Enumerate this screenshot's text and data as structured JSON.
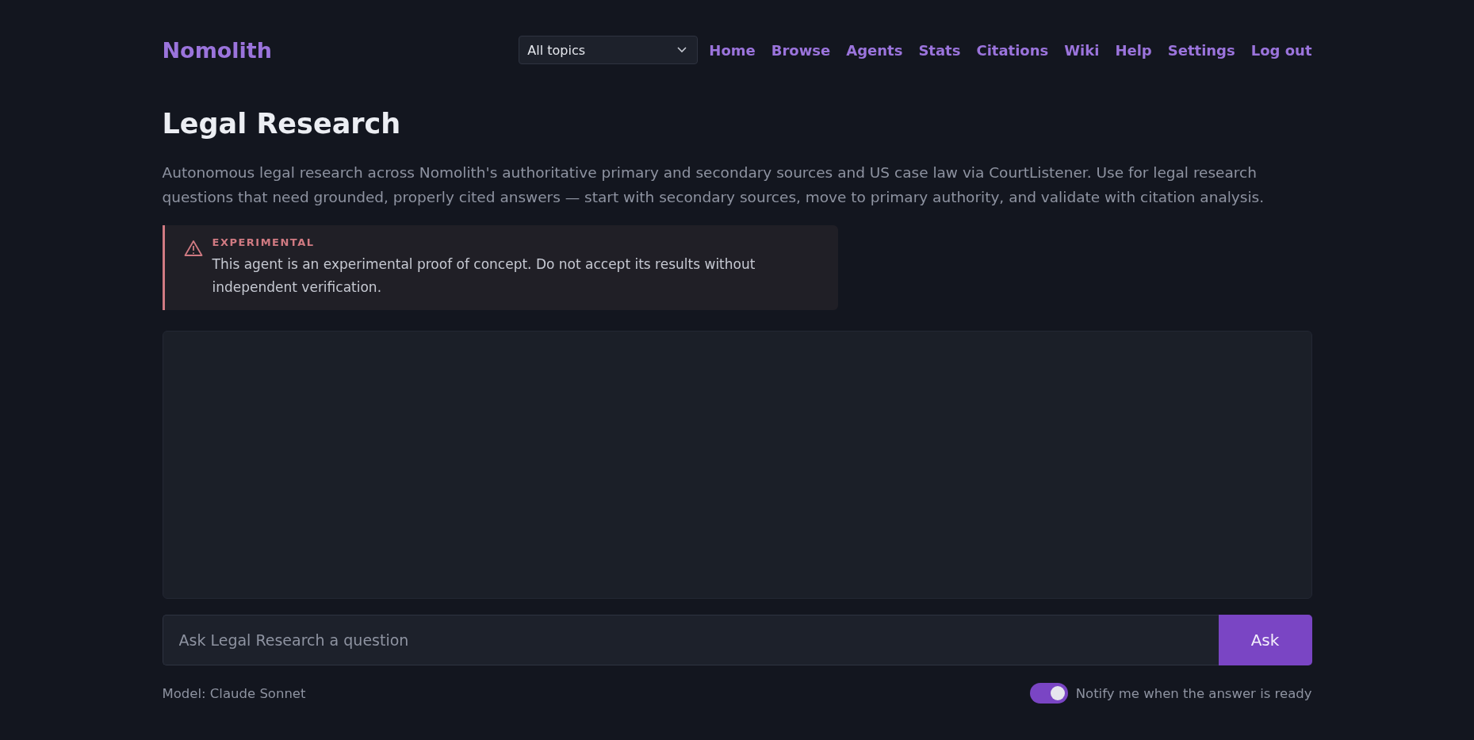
{
  "brand": "Nomolith",
  "topic_select": {
    "value": "All topics"
  },
  "nav": [
    {
      "label": "Home"
    },
    {
      "label": "Browse"
    },
    {
      "label": "Agents"
    },
    {
      "label": "Stats"
    },
    {
      "label": "Citations"
    },
    {
      "label": "Wiki"
    },
    {
      "label": "Help"
    },
    {
      "label": "Settings"
    },
    {
      "label": "Log out"
    }
  ],
  "title": "Legal Research",
  "description": "Autonomous legal research across Nomolith's authoritative primary and secondary sources and US case law via CourtListener. Use for legal research questions that need grounded, properly cited answers — start with secondary sources, move to primary authority, and validate with citation analysis.",
  "warning": {
    "heading": "EXPERIMENTAL",
    "text": "This agent is an experimental proof of concept. Do not accept its results without independent verification."
  },
  "question": {
    "placeholder": "Ask Legal Research a question",
    "button": "Ask"
  },
  "model": "Model: Claude Sonnet",
  "notify": {
    "label": "Notify me when the answer is ready",
    "on": true
  }
}
